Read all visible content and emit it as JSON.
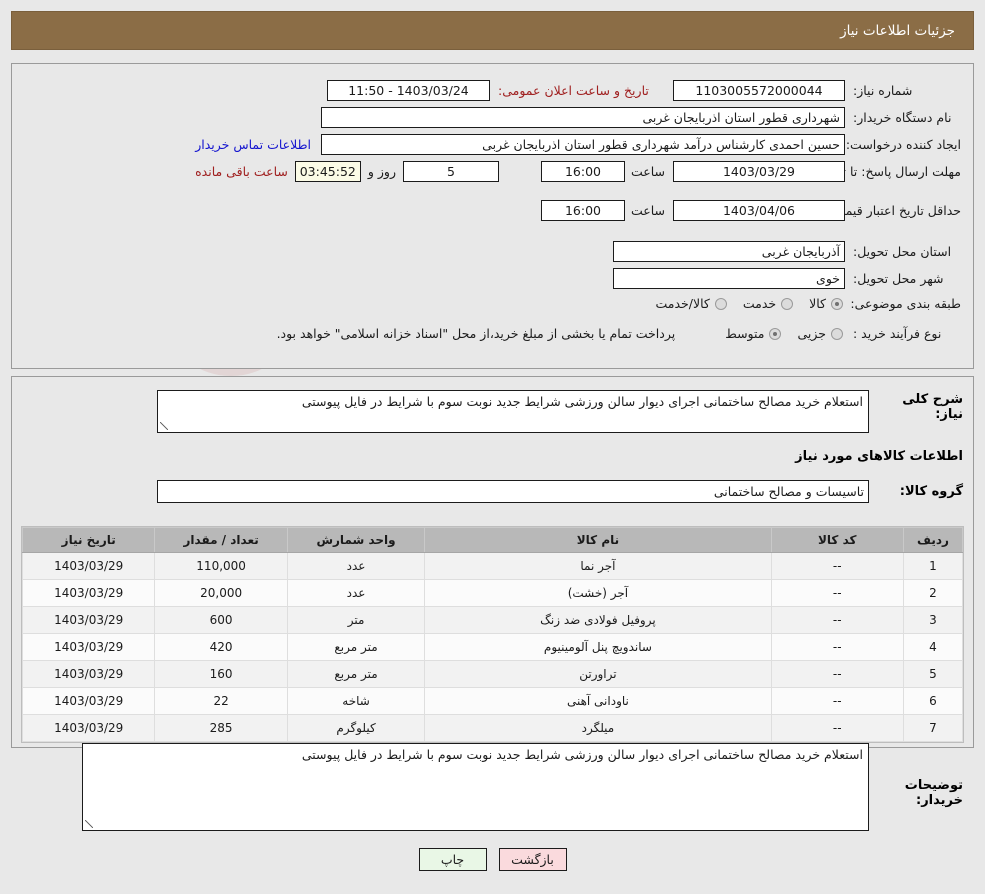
{
  "header": {
    "title": "جزئیات اطلاعات نیاز"
  },
  "watermark": {
    "text": "AriaTender.net"
  },
  "top_panel": {
    "need_number_label": "شماره نیاز:",
    "need_number_value": "1103005572000044",
    "public_announce_label": "تاریخ و ساعت اعلان عمومی:",
    "public_announce_value": "1403/03/24 - 11:50",
    "buyer_org_label": "نام دستگاه خریدار:",
    "buyer_org_value": "شهرداری قطور استان اذربایجان غربی",
    "requester_label": "ایجاد کننده درخواست:",
    "requester_value": "حسین احمدی کارشناس درآمد شهرداری قطور استان اذربایجان غربی",
    "contact_link": "اطلاعات تماس خریدار",
    "reply_deadline_label": "مهلت ارسال پاسخ: تا تاریخ:",
    "reply_deadline_date": "1403/03/29",
    "reply_deadline_time_label": "ساعت",
    "reply_deadline_time": "16:00",
    "days_value": "5",
    "days_label": "روز و",
    "countdown_value": "03:45:52",
    "countdown_label": "ساعت باقی مانده",
    "price_validity_label": "حداقل تاریخ اعتبار قیمت: تا تاریخ:",
    "price_validity_date": "1403/04/06",
    "price_validity_time_label": "ساعت",
    "price_validity_time": "16:00",
    "province_label": "استان محل تحویل:",
    "province_value": "آذربایجان غربی",
    "city_label": "شهر محل تحویل:",
    "city_value": "خوی",
    "classification_label": "طبقه بندی موضوعی:",
    "classification_options": [
      {
        "label": "کالا",
        "selected": true
      },
      {
        "label": "خدمت",
        "selected": false
      },
      {
        "label": "کالا/خدمت",
        "selected": false
      }
    ],
    "purchase_type_label": "نوع فرآیند خرید :",
    "purchase_type_options": [
      {
        "label": "جزیی",
        "selected": false
      },
      {
        "label": "متوسط",
        "selected": true
      }
    ],
    "payment_note": "پرداخت تمام یا بخشی از مبلغ خرید،از محل \"اسناد خزانه اسلامی\" خواهد بود."
  },
  "mid_panel": {
    "general_desc_label": "شرح کلی نیاز:",
    "general_desc_value": "استعلام خرید مصالح ساختمانی اجرای دیوار سالن ورزشی شرایط جدید نوبت سوم با شرایط در فایل پیوستی",
    "goods_section_title": "اطلاعات کالاهای مورد نیاز",
    "goods_group_label": "گروه کالا:",
    "goods_group_value": "تاسیسات و مصالح ساختمانی",
    "table": {
      "headers": [
        "ردیف",
        "کد کالا",
        "نام کالا",
        "واحد شمارش",
        "تعداد / مقدار",
        "تاریخ نیاز"
      ],
      "rows": [
        [
          "1",
          "--",
          "آجر نما",
          "عدد",
          "110,000",
          "1403/03/29"
        ],
        [
          "2",
          "--",
          "آجر (خشت)",
          "عدد",
          "20,000",
          "1403/03/29"
        ],
        [
          "3",
          "--",
          "پروفیل فولادی ضد زنگ",
          "متر",
          "600",
          "1403/03/29"
        ],
        [
          "4",
          "--",
          "ساندویچ پنل آلومینیوم",
          "متر مربع",
          "420",
          "1403/03/29"
        ],
        [
          "5",
          "--",
          "تراورتن",
          "متر مربع",
          "160",
          "1403/03/29"
        ],
        [
          "6",
          "--",
          "ناودانی آهنی",
          "شاخه",
          "22",
          "1403/03/29"
        ],
        [
          "7",
          "--",
          "میلگرد",
          "کیلوگرم",
          "285",
          "1403/03/29"
        ]
      ]
    },
    "buyer_notes_label": "توضیحات خریدار:",
    "buyer_notes_value": "استعلام خرید مصالح ساختمانی اجرای دیوار سالن ورزشی شرایط جدید نوبت سوم با شرایط در فایل پیوستی"
  },
  "footer": {
    "back_button": "بازگشت",
    "print_button": "چاپ"
  },
  "colors": {
    "header_bg": "#8b6d46",
    "page_bg": "#e8e8e8",
    "link": "#1414cf",
    "alert": "#a02020",
    "back_button_bg": "#fadadd",
    "print_button_bg": "#e9f7e6",
    "table_header_bg": "#b8b8b8"
  }
}
